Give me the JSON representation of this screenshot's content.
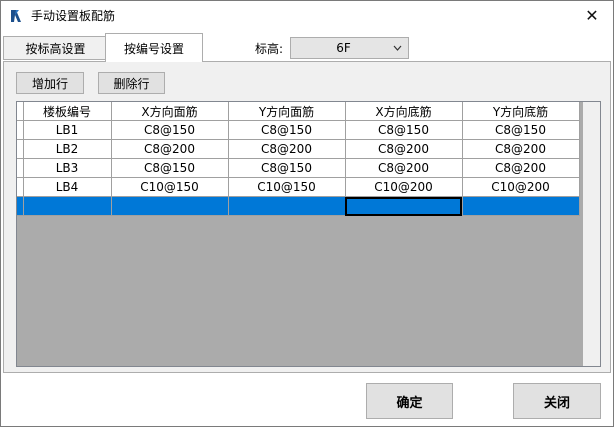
{
  "window": {
    "title": "手动设置板配筋",
    "close_glyph": "✕"
  },
  "tabs": [
    {
      "label": "按标高设置",
      "active": false
    },
    {
      "label": "按编号设置",
      "active": true
    }
  ],
  "elevation": {
    "label": "标高:",
    "selected": "6F"
  },
  "toolbar": {
    "add_row": "增加行",
    "delete_row": "删除行"
  },
  "grid": {
    "columns": [
      "楼板编号",
      "X方向面筋",
      "Y方向面筋",
      "X方向底筋",
      "Y方向底筋"
    ],
    "rows": [
      [
        "LB1",
        "C8@150",
        "C8@150",
        "C8@150",
        "C8@150"
      ],
      [
        "LB2",
        "C8@200",
        "C8@200",
        "C8@200",
        "C8@200"
      ],
      [
        "LB3",
        "C8@150",
        "C8@150",
        "C8@200",
        "C8@200"
      ],
      [
        "LB4",
        "C10@150",
        "C10@150",
        "C10@200",
        "C10@200"
      ]
    ],
    "selection_color": "#0078d7"
  },
  "footer": {
    "ok": "确定",
    "close": "关闭"
  }
}
